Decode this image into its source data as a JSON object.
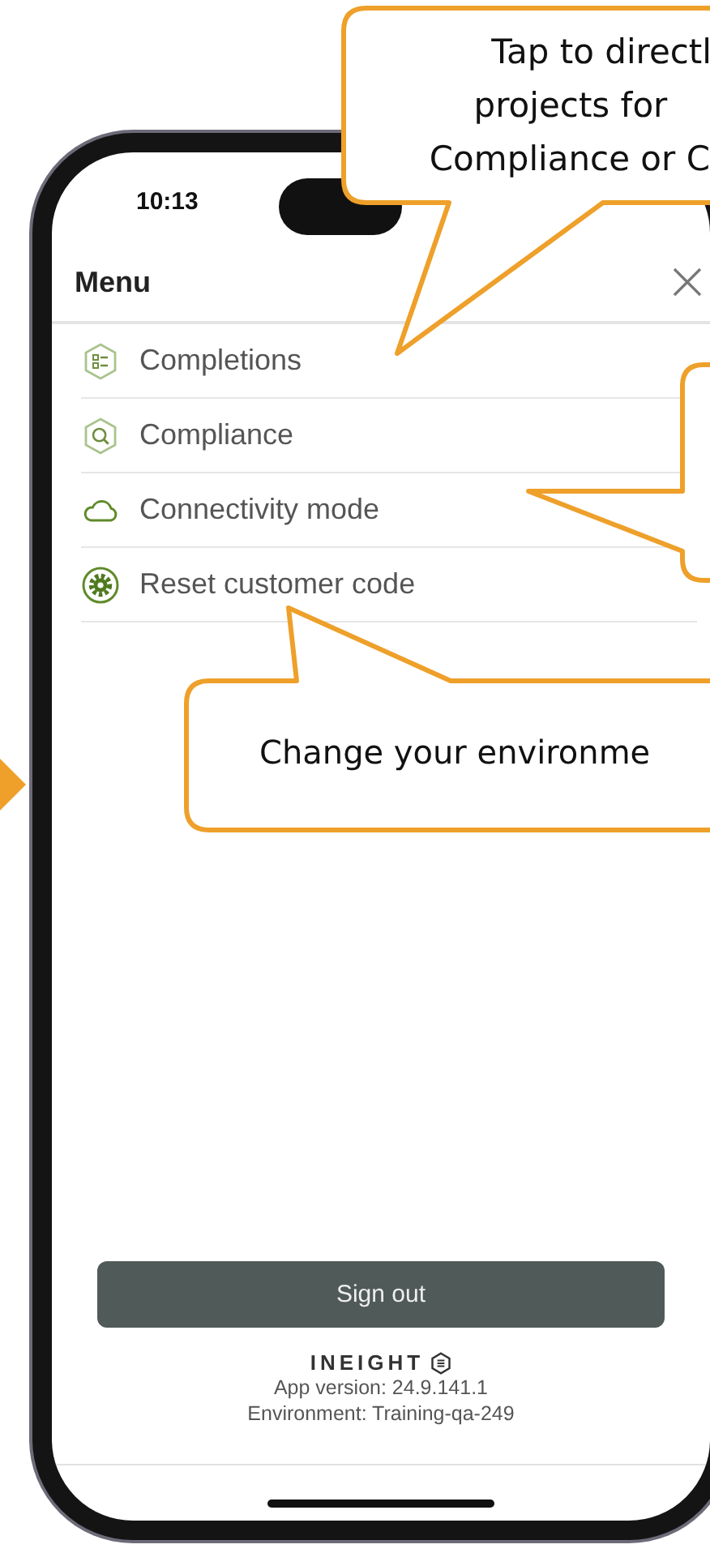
{
  "callouts": [
    {
      "lines": [
        "Tap to directl",
        "projects for",
        "Compliance or C"
      ]
    },
    {
      "lines": [
        "Change your environme"
      ]
    }
  ],
  "phone": {
    "time": "10:13",
    "menu_title": "Menu",
    "items": [
      {
        "label": "Completions",
        "kind": "checklist"
      },
      {
        "label": "Compliance",
        "kind": "search"
      },
      {
        "label": "Connectivity mode",
        "kind": "cloud"
      },
      {
        "label": "Reset customer code",
        "kind": "gear"
      }
    ],
    "sign_out": "Sign out",
    "logo": "INEIGHT",
    "app_version": "App version: 24.9.141.1",
    "environment": "Environment: Training-qa-249"
  }
}
